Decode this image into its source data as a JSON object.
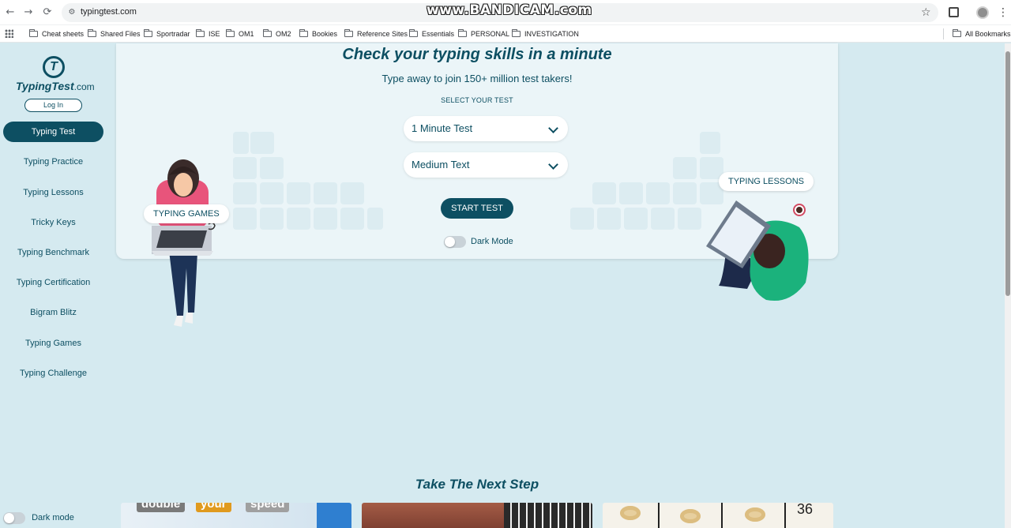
{
  "browser": {
    "url": "typingtest.com",
    "watermark": "www.BANDICAM.com",
    "bookmarks": [
      "Cheat sheets",
      "Shared Files",
      "Sportradar",
      "ISE",
      "OM1",
      "OM2",
      "Bookies",
      "Reference Sites",
      "Essentials",
      "PERSONAL",
      "INVESTIGATION"
    ],
    "all_bookmarks": "All Bookmarks"
  },
  "sidebar": {
    "logo_name": "TypingTest",
    "logo_suffix": ".com",
    "login": "Log In",
    "items": [
      {
        "label": "Typing Test",
        "active": true
      },
      {
        "label": "Typing Practice"
      },
      {
        "label": "Typing Lessons"
      },
      {
        "label": "Tricky Keys"
      },
      {
        "label": "Typing Benchmark"
      },
      {
        "label": "Typing Certification"
      },
      {
        "label": "Bigram Blitz"
      },
      {
        "label": "Typing Games"
      },
      {
        "label": "Typing Challenge"
      }
    ],
    "dark_mode": "Dark mode"
  },
  "hero": {
    "title": "Check your typing skills in a minute",
    "subtitle": "Type away to join 150+ million test takers!",
    "select_label": "SELECT YOUR TEST",
    "test_duration": "1 Minute Test",
    "text_difficulty": "Medium Text",
    "start": "START TEST",
    "dark_mode": "Dark Mode",
    "games_label": "TYPING GAMES",
    "lessons_label": "TYPING LESSONS"
  },
  "next_step": {
    "title": "Take The Next Step",
    "card1_words": [
      "double",
      "your",
      "speed"
    ],
    "card3_number": "36"
  },
  "colors": {
    "primary": "#0d4f62",
    "page_bg": "#d5eaf0",
    "card_bg": "#ebf5f8"
  }
}
